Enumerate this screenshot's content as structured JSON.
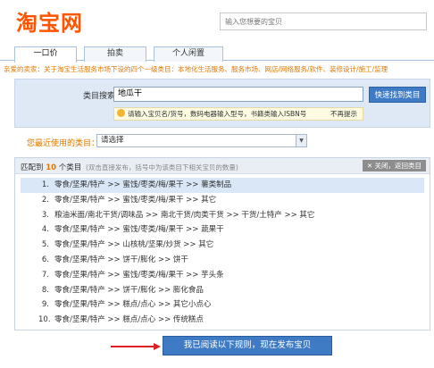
{
  "header": {
    "logo": "淘宝网",
    "search_placeholder": "输入您想要的宝贝"
  },
  "tabs": [
    {
      "label": "一口价"
    },
    {
      "label": "拍卖"
    },
    {
      "label": "个人闲置"
    }
  ],
  "notice": "亲爱的卖家：关于淘宝生活服务市场下设的四个一级类目：本地化生活服务、服务市场、网店/网络服务/软件、装修设计/施工/监理",
  "category_search": {
    "label": "类目搜索：",
    "value": "地瓜干",
    "button": "快速找到类目",
    "tip": "请输入宝贝名/货号，数码电器输入型号，书籍类输入ISBN号",
    "tip_dismiss": "不再提示"
  },
  "recent": {
    "label": "您最近使用的类目：",
    "selected": "请选择"
  },
  "results": {
    "match_prefix": "匹配到",
    "match_count": "10",
    "match_suffix": "个类目",
    "match_hint": "(双击直接发布，括号中为该类目下相关宝贝的数量)",
    "close_label": "关闭，返回类目",
    "items": [
      {
        "index": "1.",
        "path": "零食/坚果/特产 >> 蜜饯/枣类/梅/果干 >> 薯类制品"
      },
      {
        "index": "2.",
        "path": "零食/坚果/特产 >> 蜜饯/枣类/梅/果干 >> 其它"
      },
      {
        "index": "3.",
        "path": "粮油米面/南北干货/调味品 >> 南北干货/肉类干货 >> 干货/土特产 >> 其它"
      },
      {
        "index": "4.",
        "path": "零食/坚果/特产 >> 蜜饯/枣类/梅/果干 >> 蔬果干"
      },
      {
        "index": "5.",
        "path": "零食/坚果/特产 >> 山核桃/坚果/炒货 >> 其它"
      },
      {
        "index": "6.",
        "path": "零食/坚果/特产 >> 饼干/膨化 >> 饼干"
      },
      {
        "index": "7.",
        "path": "零食/坚果/特产 >> 蜜饯/枣类/梅/果干 >> 芋头条"
      },
      {
        "index": "8.",
        "path": "零食/坚果/特产 >> 饼干/膨化 >> 膨化食品"
      },
      {
        "index": "9.",
        "path": "零食/坚果/特产 >> 糕点/点心 >> 其它小点心"
      },
      {
        "index": "10.",
        "path": "零食/坚果/特产 >> 糕点/点心 >> 传统糕点"
      }
    ]
  },
  "publish_button": "我已阅读以下规则，现在发布宝贝",
  "colors": {
    "brand": "#ff5500",
    "accent_blue": "#3f7bc4",
    "warning_orange": "#e07800",
    "panel_bg": "#dfe9f5"
  }
}
